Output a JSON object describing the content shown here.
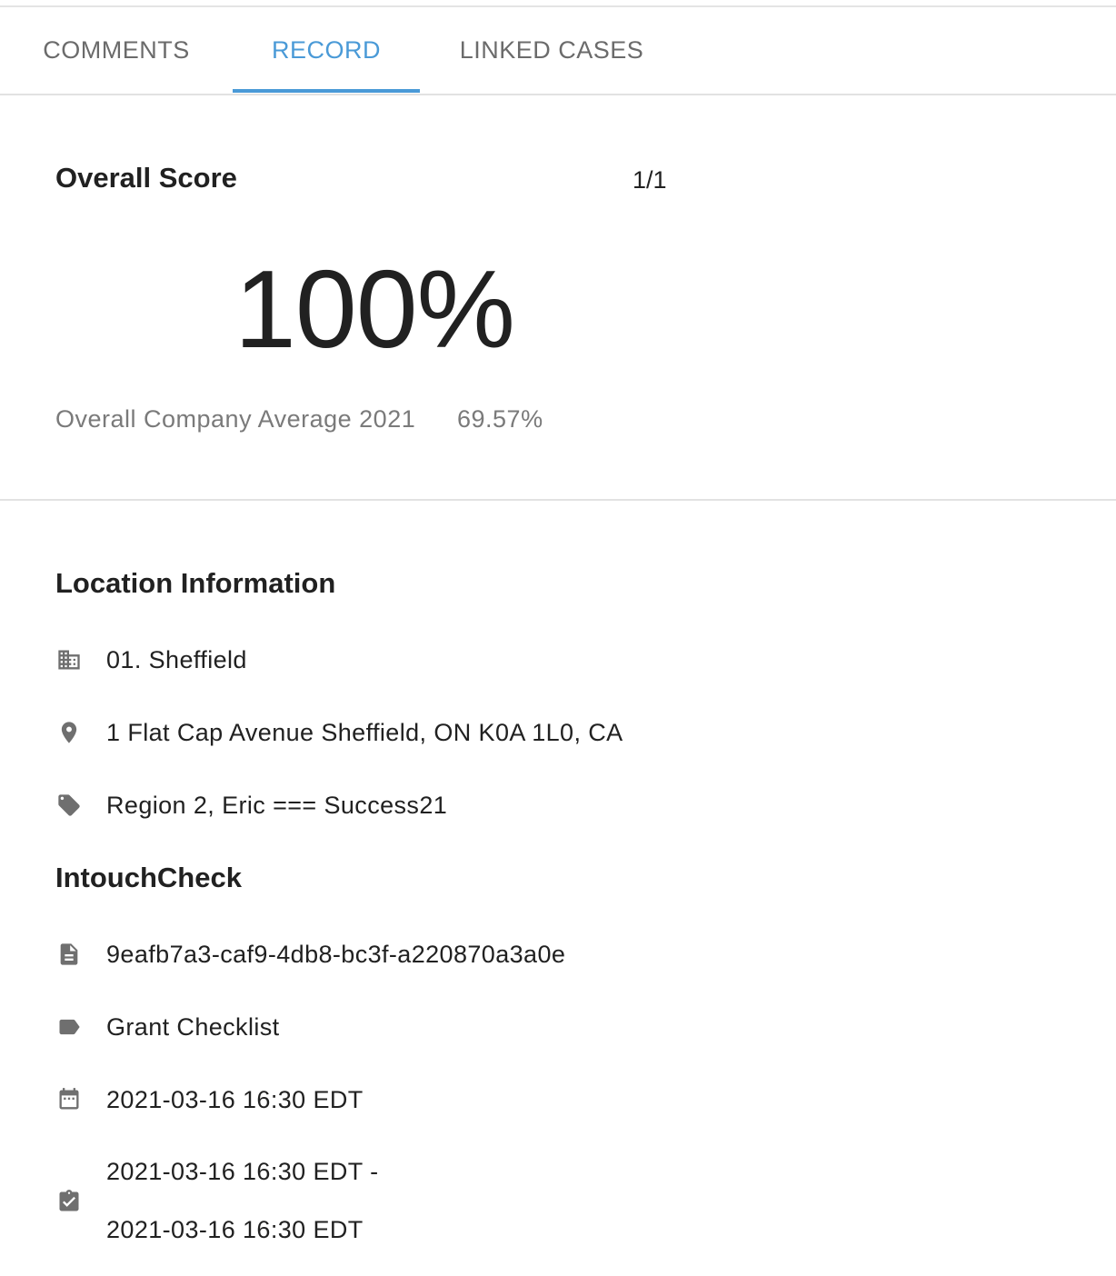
{
  "tabs": [
    {
      "label": "COMMENTS",
      "active": false
    },
    {
      "label": "RECORD",
      "active": true
    },
    {
      "label": "LINKED CASES",
      "active": false
    }
  ],
  "accent_color": "#4a9ad7",
  "score": {
    "title": "Overall Score",
    "count": "1/1",
    "value": "100%",
    "average_label": "Overall Company Average 2021",
    "average_value": "69.57%"
  },
  "location": {
    "title": "Location Information",
    "items": [
      {
        "icon": "building-icon",
        "text": "01. Sheffield"
      },
      {
        "icon": "location-pin-icon",
        "text": "1 Flat Cap Avenue Sheffield, ON K0A 1L0, CA"
      },
      {
        "icon": "tag-icon",
        "text": "Region 2, Eric === Success21"
      }
    ]
  },
  "check": {
    "title": "IntouchCheck",
    "items": [
      {
        "icon": "document-icon",
        "text": "9eafb7a3-caf9-4db8-bc3f-a220870a3a0e"
      },
      {
        "icon": "label-icon",
        "text": "Grant Checklist"
      },
      {
        "icon": "calendar-icon",
        "text": "2021-03-16 16:30 EDT"
      }
    ],
    "range": {
      "icon": "clipboard-check-icon",
      "line1": "2021-03-16 16:30 EDT -",
      "line2": "2021-03-16 16:30 EDT"
    }
  }
}
